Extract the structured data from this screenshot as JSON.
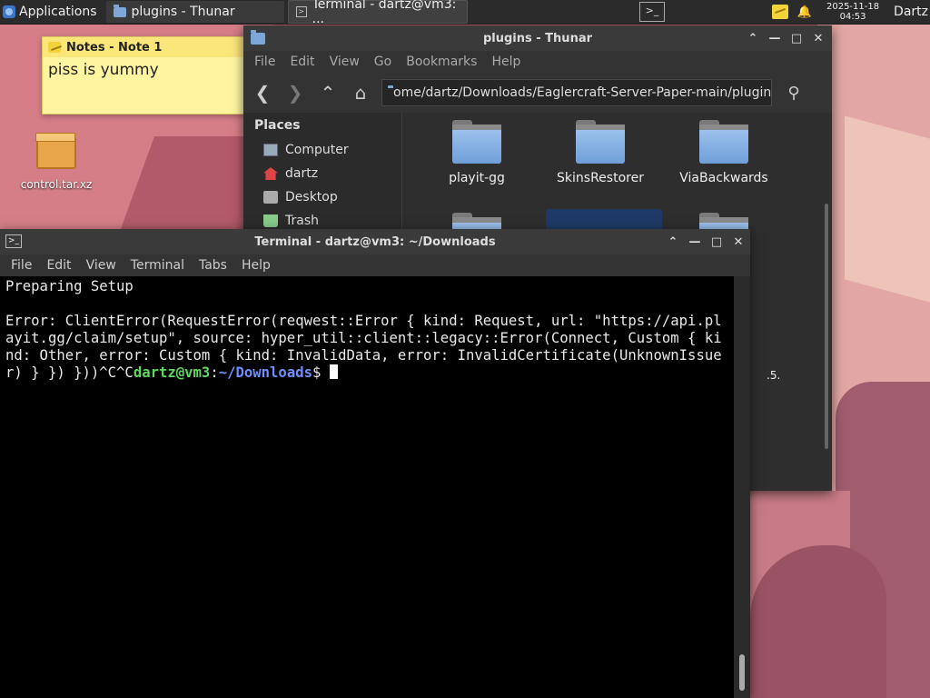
{
  "panel": {
    "applications": "Applications",
    "tasks": [
      {
        "label": "plugins - Thunar"
      },
      {
        "label": "Terminal - dartz@vm3: ..."
      }
    ],
    "clock_date": "2025-11-18",
    "clock_time": "04:53",
    "user": "Dartz"
  },
  "desktop": {
    "icon_label": "control.tar.xz"
  },
  "note": {
    "title": "Notes - Note 1",
    "body": "piss  is yummy"
  },
  "thunar": {
    "title": "plugins - Thunar",
    "menu": [
      "File",
      "Edit",
      "View",
      "Go",
      "Bookmarks",
      "Help"
    ],
    "path": "ome/dartz/Downloads/Eaglercraft-Server-Paper-main/plugins/",
    "sidebar_heading": "Places",
    "places": [
      "Computer",
      "dartz",
      "Desktop",
      "Trash"
    ],
    "files": [
      "playit-gg",
      "SkinsRestorer",
      "ViaBackwards"
    ],
    "partial_text": ".5."
  },
  "terminal": {
    "title": "Terminal - dartz@vm3: ~/Downloads",
    "menu": [
      "File",
      "Edit",
      "View",
      "Terminal",
      "Tabs",
      "Help"
    ],
    "line1": "Preparing Setup",
    "error": "Error: ClientError(RequestError(reqwest::Error { kind: Request, url: \"https://api.playit.gg/claim/setup\", source: hyper_util::client::legacy::Error(Connect, Custom { kind: Other, error: Custom { kind: InvalidData, error: InvalidCertificate(UnknownIssuer) } }) }))^C^C",
    "prompt_user": "dartz@vm3",
    "prompt_sep": ":",
    "prompt_path": "~/Downloads",
    "prompt_end": "$ "
  },
  "colors": {
    "prompt_user": "#5fd75f",
    "prompt_path": "#6f8fff",
    "terminal_bg": "#000000",
    "window_bg": "#2e2e2e"
  }
}
